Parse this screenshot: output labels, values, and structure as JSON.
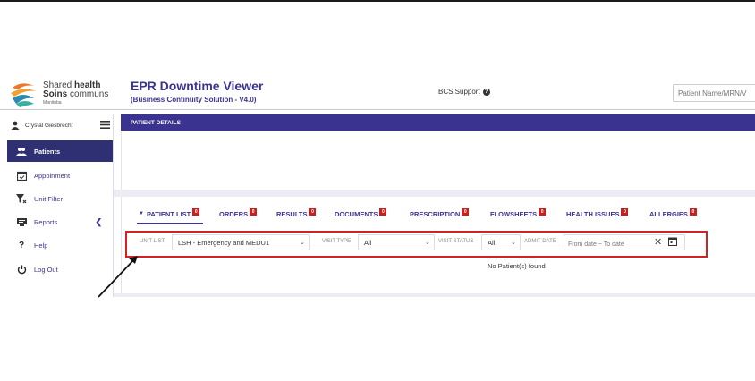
{
  "brand": {
    "line1_plain": "Shared ",
    "line1_bold": "health",
    "line2_bold": "Soins ",
    "line2_plain": "communs",
    "line3": "Manitoba"
  },
  "app": {
    "title": "EPR Downtime Viewer",
    "subtitle": "(Business Continuity Solution - V4.0)"
  },
  "header": {
    "support_label": "BCS Support",
    "search_placeholder": "Patient Name/MRN/V"
  },
  "sidebar": {
    "user_name": "Crystal Giesbrecht",
    "items": [
      {
        "label": "Patients",
        "icon": "patients-icon",
        "active": true
      },
      {
        "label": "Appoinment",
        "icon": "calendar-icon",
        "active": false
      },
      {
        "label": "Unit Filter",
        "icon": "filter-icon",
        "active": false
      },
      {
        "label": "Reports",
        "icon": "reports-icon",
        "active": false
      },
      {
        "label": "Help",
        "icon": "question-icon",
        "active": false
      },
      {
        "label": "Log Out",
        "icon": "power-icon",
        "active": false
      }
    ]
  },
  "patient_details": {
    "title": "PATIENT DETAILS"
  },
  "tabs": [
    {
      "label": "PATIENT LIST",
      "badge": "0",
      "active": true
    },
    {
      "label": "ORDERS",
      "badge": "0"
    },
    {
      "label": "RESULTS",
      "badge": "0"
    },
    {
      "label": "DOCUMENTS",
      "badge": "0"
    },
    {
      "label": "PRESCRIPTION",
      "badge": "0"
    },
    {
      "label": "FLOWSHEETS",
      "badge": "0"
    },
    {
      "label": "HEALTH ISSUES",
      "badge": "0"
    },
    {
      "label": "ALLERGIES",
      "badge": "0"
    }
  ],
  "filters": {
    "unit_list_label": "UNIT LIST",
    "unit_list_value": "LSH - Emergency and MEDU1",
    "visit_type_label": "VISIT TYPE",
    "visit_type_value": "All",
    "visit_status_label": "VISIT STATUS",
    "visit_status_value": "All",
    "admit_date_label": "ADMIT DATE",
    "admit_date_placeholder": "From date ~ To date"
  },
  "result_message": "No Patient(s) found",
  "colors": {
    "brand_purple": "#3a3390",
    "sidebar_active": "#2f2f74",
    "badge_red": "#c82020",
    "highlight_red": "#d42222"
  }
}
